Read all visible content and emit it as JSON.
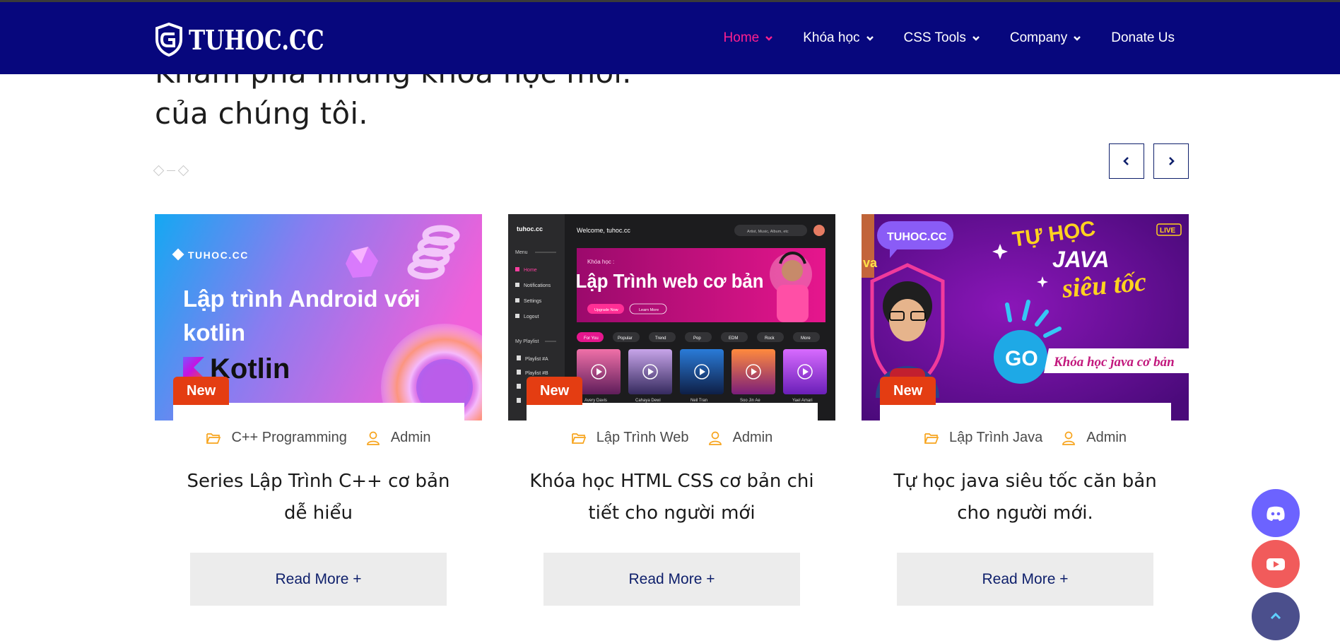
{
  "header": {
    "logo_text": "TUHOC.CC",
    "nav": [
      {
        "label": "Home"
      },
      {
        "label": "Khóa học"
      },
      {
        "label": "CSS Tools"
      },
      {
        "label": "Company"
      },
      {
        "label": "Donate Us"
      }
    ],
    "colors": {
      "background": "#07077d",
      "active": "#ff1f8f"
    }
  },
  "section": {
    "heading_line1": "Khám phá những khóa học mới.",
    "heading_line2": "của chúng tôi."
  },
  "carousel": {
    "prev_icon": "chevron-left-icon",
    "next_icon": "chevron-right-icon"
  },
  "cards": [
    {
      "badge": "New",
      "category": "C++ Programming",
      "author": "Admin",
      "title": "Series Lập Trình C++ cơ bản dễ hiểu",
      "read_more": "Read More +",
      "thumb": {
        "brand": "TUHOC.CC",
        "headline_1": "Lập trình Android với",
        "headline_2": "kotlin",
        "logo_word": "Kotlin"
      }
    },
    {
      "badge": "New",
      "category": "Lập Trình Web",
      "author": "Admin",
      "title": "Khóa học HTML CSS cơ bản chi tiết cho người mới",
      "read_more": "Read More +",
      "thumb": {
        "brand": "tuhoc.cc",
        "welcome": "Welcome, tuhoc.cc",
        "search_placeholder": "Artist, Music, Album, etc",
        "menu_title": "Menu",
        "menu": [
          "Home",
          "Notifications",
          "Settings",
          "Logout"
        ],
        "playlist_title": "My Playlist",
        "playlists": [
          "Playlist #A",
          "Playlist #B"
        ],
        "banner_kicker": "Khóa học :",
        "banner_title": "Lập Trình web cơ bản",
        "banner_btn1": "Upgrade Now",
        "banner_btn2": "Learn More",
        "chips": [
          "For You",
          "Popular",
          "Trend",
          "Pop",
          "EDM",
          "Rock",
          "More"
        ],
        "artists": [
          "Avery Davis",
          "Cahaya Dewi",
          "Neil Tran",
          "Soo Jin Ae",
          "Yael Amari"
        ]
      }
    },
    {
      "badge": "New",
      "category": "Lập Trình Java",
      "author": "Admin",
      "title": "Tự học java siêu tốc căn bản cho người mới.",
      "read_more": "Read More +",
      "thumb": {
        "brand": "TUHOC.CC",
        "line1": "TỰ HỌC",
        "line2": "JAVA",
        "line3": "siêu tốc",
        "go": "GO",
        "live": "LIVE",
        "ribbon": "Khóa học java cơ bản"
      }
    }
  ],
  "floating": [
    {
      "icon": "discord-icon",
      "color": "#6c63ff"
    },
    {
      "icon": "youtube-icon",
      "color": "#f15b5b"
    },
    {
      "icon": "chevron-up-icon",
      "color": "#4b4f8c"
    }
  ]
}
